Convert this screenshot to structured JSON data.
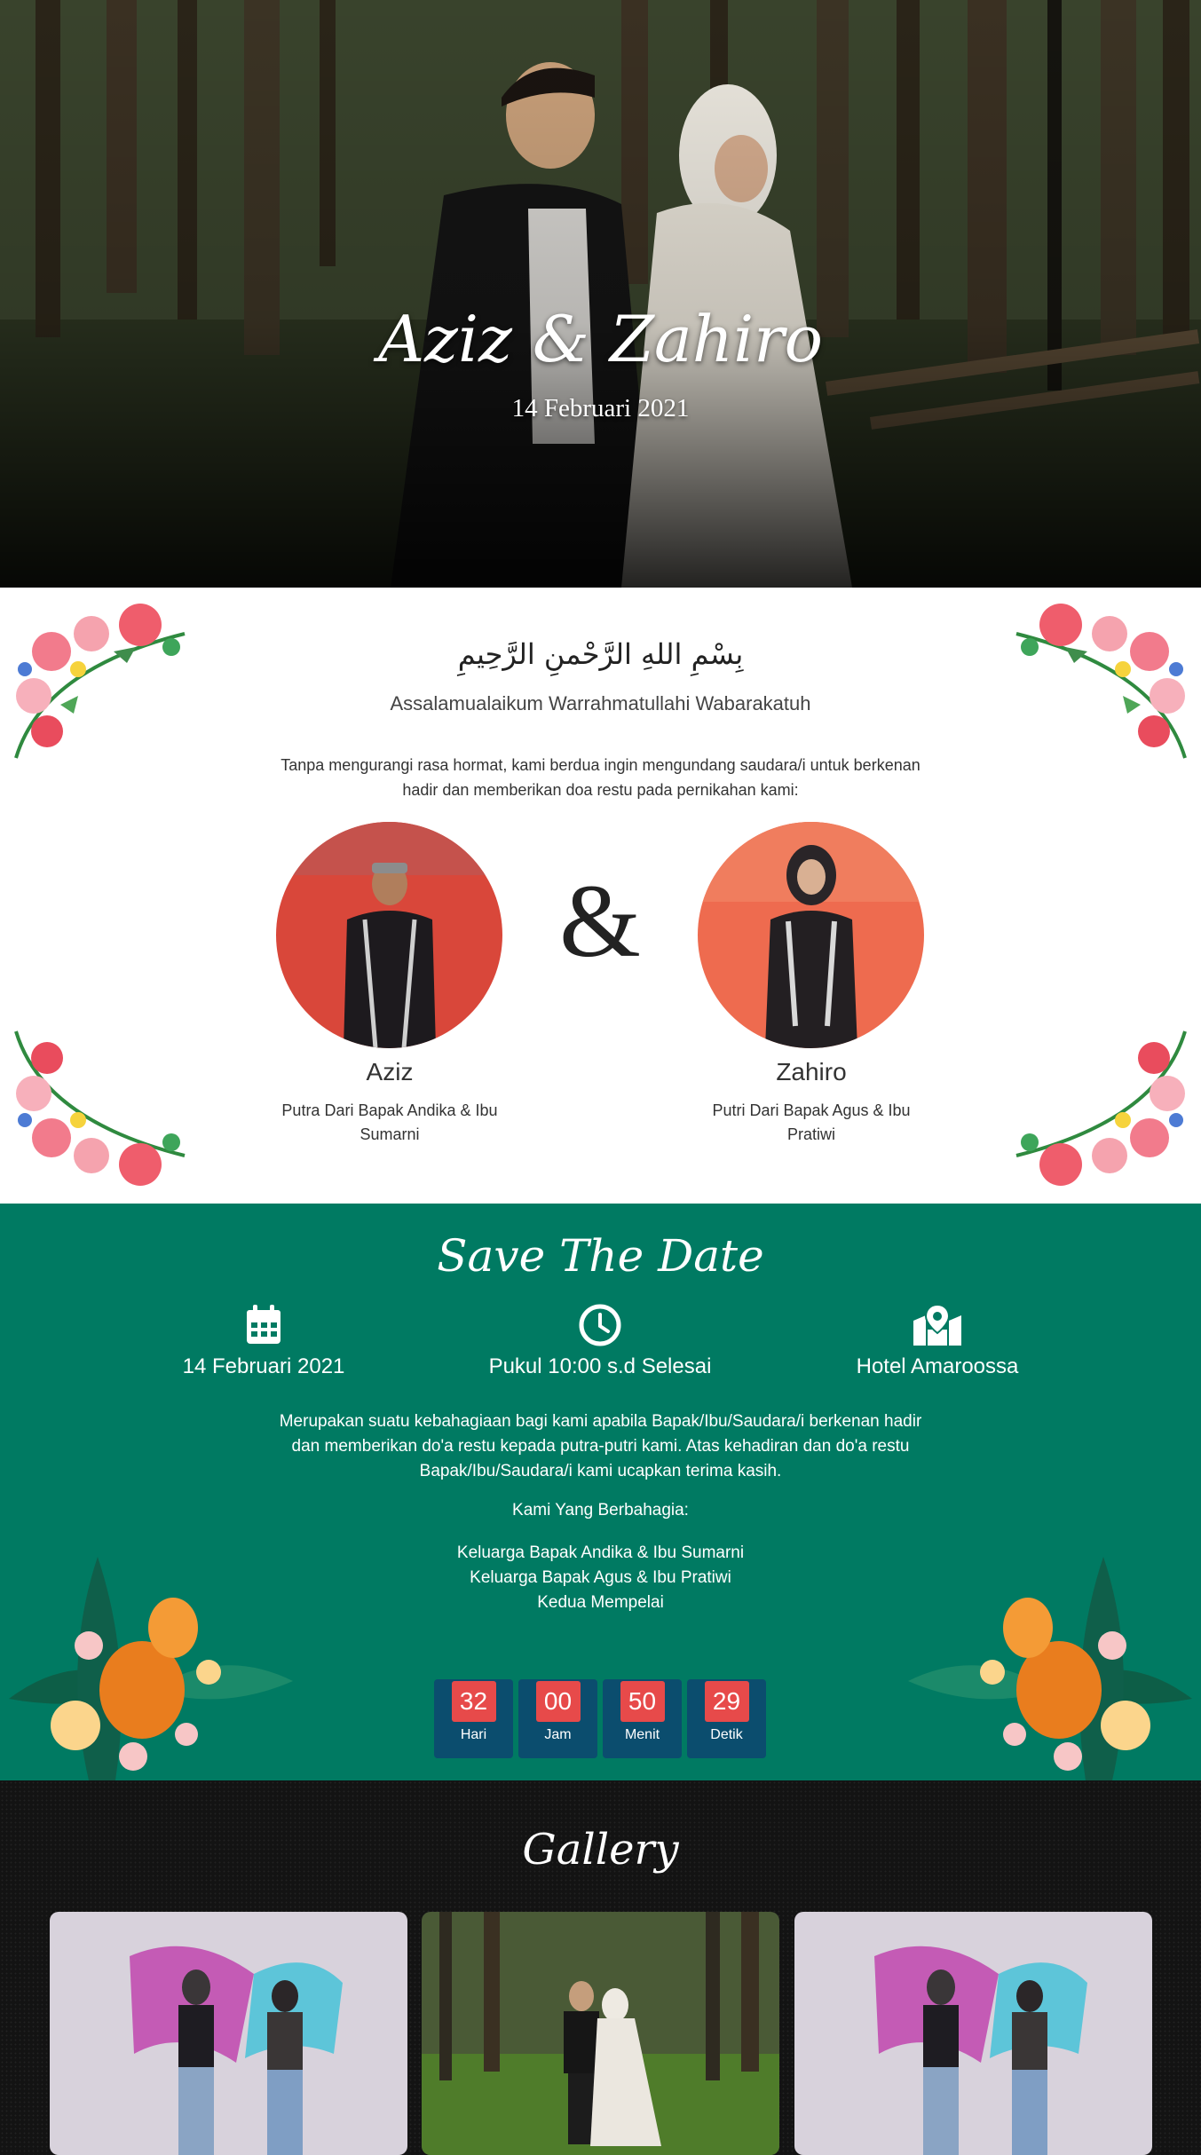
{
  "hero": {
    "title": "Aziz & Zahiro",
    "date": "14 Februari 2021"
  },
  "greeting": {
    "bismillah": "بِسْمِ اللهِ الرَّحْمنِ الرَّحِيمِ",
    "salam": "Assalamualaikum Warrahmatullahi Wabarakatuh",
    "intro": "Tanpa mengurangi rasa hormat, kami berdua ingin mengundang saudara/i untuk berkenan hadir dan memberikan doa restu pada pernikahan kami:"
  },
  "couple": {
    "ampersand": "&",
    "groom": {
      "name": "Aziz",
      "parents": "Putra Dari Bapak Andika & Ibu Sumarni"
    },
    "bride": {
      "name": "Zahiro",
      "parents": "Putri Dari Bapak Agus & Ibu Pratiwi"
    }
  },
  "save_the_date": {
    "title": "Save The Date",
    "date": {
      "icon": "calendar-icon",
      "text": "14 Februari 2021"
    },
    "time": {
      "icon": "clock-icon",
      "text": "Pukul 10:00 s.d Selesai"
    },
    "venue": {
      "icon": "map-marker-icon",
      "text": "Hotel Amaroossa"
    },
    "message": "Merupakan suatu kebahagiaan bagi kami apabila Bapak/Ibu/Saudara/i berkenan hadir dan memberikan do'a restu kepada putra-putri kami. Atas kehadiran dan do'a restu Bapak/Ibu/Saudara/i kami ucapkan terima kasih.",
    "thanks_label": "Kami Yang Berbahagia:",
    "families": [
      "Keluarga Bapak Andika & Ibu Sumarni",
      "Keluarga Bapak Agus & Ibu Pratiwi",
      "Kedua Mempelai"
    ]
  },
  "countdown": [
    {
      "value": "32",
      "label": "Hari"
    },
    {
      "value": "00",
      "label": "Jam"
    },
    {
      "value": "50",
      "label": "Menit"
    },
    {
      "value": "29",
      "label": "Detik"
    }
  ],
  "gallery": {
    "title": "Gallery"
  },
  "colors": {
    "accent_green": "#007a62",
    "countdown_box": "#0b4d6e",
    "countdown_number": "#e74a4a",
    "gallery_bg": "#131313"
  }
}
